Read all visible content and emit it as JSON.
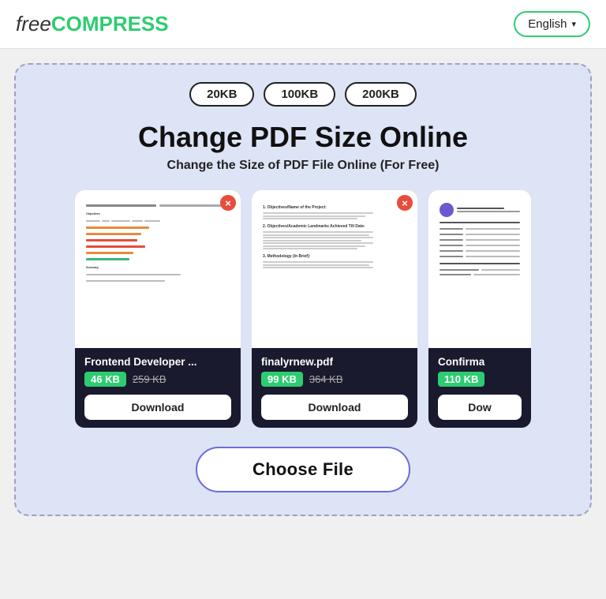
{
  "header": {
    "logo_free": "free",
    "logo_compress": "COMPRESS",
    "lang_btn": "English",
    "lang_arrow": "▾"
  },
  "size_pills": [
    "20KB",
    "100KB",
    "200KB"
  ],
  "main_title": "Change PDF Size Online",
  "sub_title": "Change the Size of PDF File Online (For Free)",
  "cards": [
    {
      "filename": "Frontend Developer ...",
      "new_size": "46 KB",
      "old_size": "259 KB",
      "download_btn": "Download",
      "close_btn": "×"
    },
    {
      "filename": "finalyrnew.pdf",
      "new_size": "99 KB",
      "old_size": "364 KB",
      "download_btn": "Download",
      "close_btn": "×"
    },
    {
      "filename": "Confirma",
      "new_size": "110 KB",
      "old_size": "",
      "download_btn": "Dow",
      "close_btn": ""
    }
  ],
  "choose_file_btn": "Choose File"
}
